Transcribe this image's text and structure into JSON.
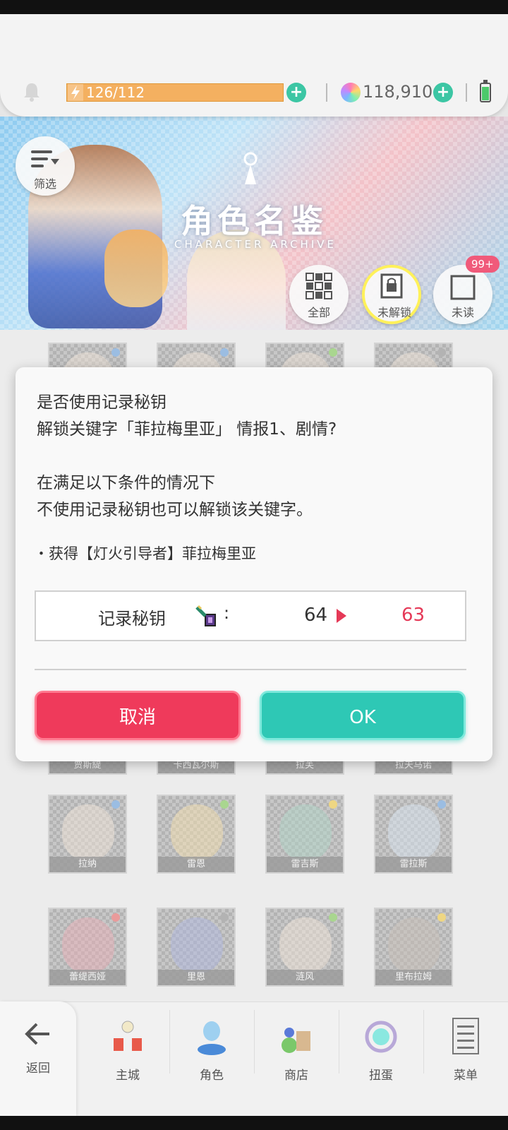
{
  "header": {
    "stamina": "126/112",
    "gems": "118,910"
  },
  "banner": {
    "title": "角色名鉴",
    "subtitle": "CHARACTER ARCHIVE",
    "filter_label": "筛选",
    "tab_all": "全部",
    "tab_locked": "未解锁",
    "tab_unread": "未读",
    "unread_badge": "99+"
  },
  "grid": {
    "row1": [
      "贾斯緹",
      "卡西瓦尔斯",
      "拉芙",
      "拉夫马诺"
    ],
    "row2": [
      "拉纳",
      "雷恩",
      "雷吉斯",
      "雷拉斯"
    ],
    "row3": [
      "蕾缇西娅",
      "里恩",
      "涟风",
      "里布拉姆"
    ]
  },
  "dialog": {
    "line1": "是否使用记录秘钥",
    "line2": "解锁关键字「菲拉梅里亚」 情报1、剧情?",
    "line3": "在满足以下条件的情况下",
    "line4": "不使用记录秘钥也可以解锁该关键字。",
    "condition": "・获得【灯火引导者】菲拉梅里亚",
    "cost_label": "记录秘钥",
    "colon": ":",
    "cost_from": "64",
    "cost_to": "63",
    "cancel": "取消",
    "ok": "OK"
  },
  "nav": {
    "back": "返回",
    "items": [
      "主城",
      "角色",
      "商店",
      "扭蛋",
      "菜单"
    ]
  },
  "colors": {
    "accent_red": "#ef3a5b",
    "accent_teal": "#2ec8b5",
    "stamina": "#f4b060"
  },
  "icons": [
    "bell-icon",
    "lightning-icon",
    "plus-icon",
    "gem-icon",
    "battery-icon",
    "filter-icon",
    "lock-icon",
    "key-icon",
    "back-arrow-icon"
  ]
}
